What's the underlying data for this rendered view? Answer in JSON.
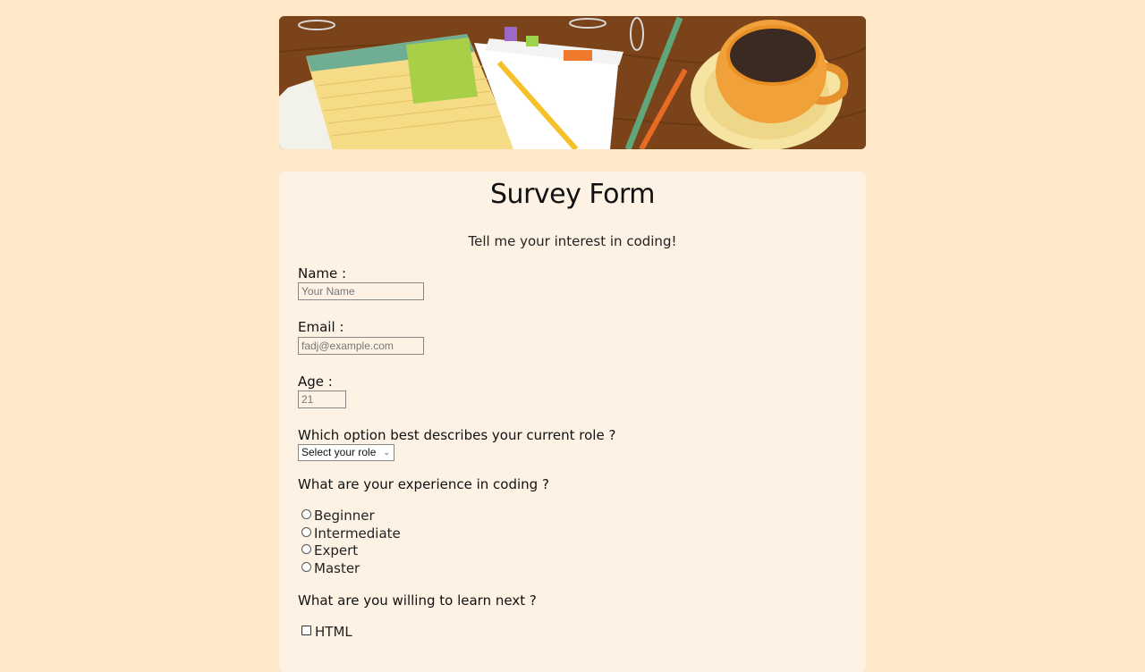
{
  "form": {
    "title": "Survey Form",
    "subtitle": "Tell me your interest in coding!",
    "name": {
      "label": "Name :",
      "placeholder": "Your Name"
    },
    "email": {
      "label": "Email :",
      "placeholder": "fadj@example.com"
    },
    "age": {
      "label": "Age :",
      "placeholder": "21"
    },
    "role": {
      "label": "Which option best describes your current role ?",
      "selected": "Select your role"
    },
    "experience": {
      "label": "What are your experience in coding ?",
      "options": [
        "Beginner",
        "Intermediate",
        "Expert",
        "Master"
      ]
    },
    "learn": {
      "label": "What are you willing to learn next ?",
      "options": [
        "HTML"
      ]
    }
  },
  "colors": {
    "page_bg": "#fee8c8",
    "card_bg": "#fdf2e3"
  }
}
